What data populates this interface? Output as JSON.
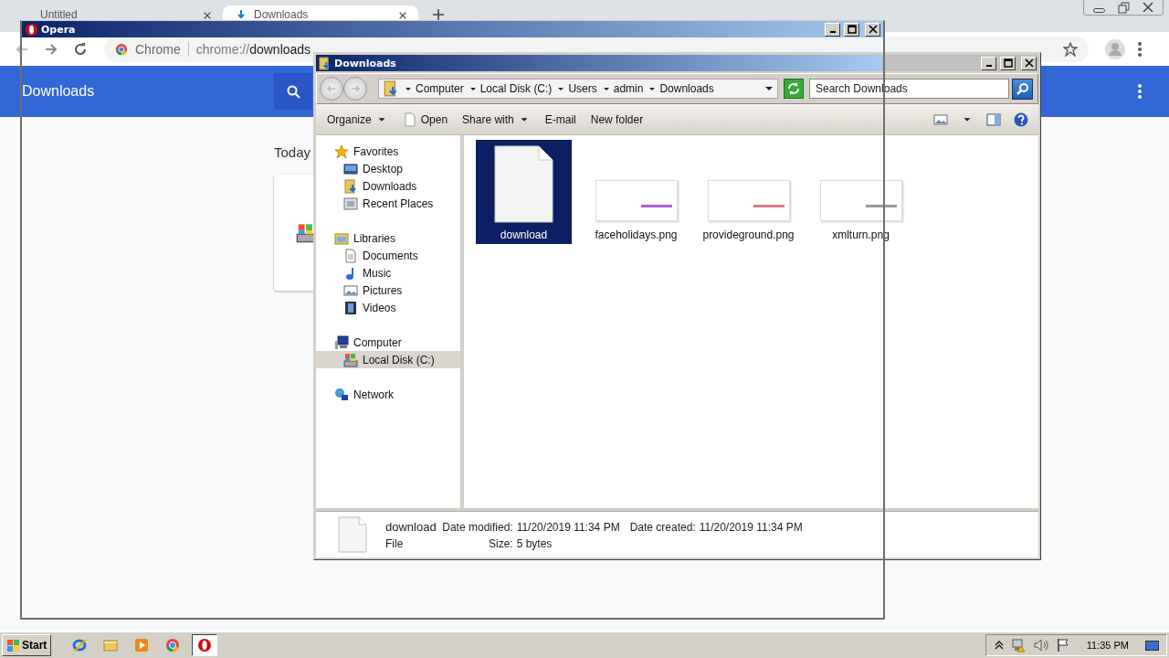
{
  "chrome": {
    "tabs": [
      {
        "label": "Untitled",
        "selected": false
      },
      {
        "label": "Downloads",
        "selected": true
      }
    ],
    "omnibox": {
      "site": "Chrome",
      "url_scheme": "chrome://",
      "url_path": "downloads"
    },
    "header": {
      "title": "Downloads"
    },
    "section": "Today"
  },
  "opera": {
    "title": "Opera"
  },
  "explorer": {
    "title": "Downloads",
    "breadcrumb": [
      "Computer",
      "Local Disk (C:)",
      "Users",
      "admin",
      "Downloads"
    ],
    "search": {
      "placeholder": "Search Downloads"
    },
    "commands": [
      {
        "label": "Organize",
        "kind": "menu"
      },
      {
        "label": "Open",
        "kind": "page"
      },
      {
        "label": "Share with",
        "kind": "menu"
      },
      {
        "label": "E-mail",
        "kind": "plain"
      },
      {
        "label": "New folder",
        "kind": "plain"
      }
    ],
    "nav": [
      {
        "label": "Favorites",
        "kind": "star",
        "selected": false,
        "children": [
          {
            "label": "Desktop",
            "kind": "desktop",
            "selected": false
          },
          {
            "label": "Downloads",
            "kind": "downloads",
            "selected": false
          },
          {
            "label": "Recent Places",
            "kind": "recent",
            "selected": false
          }
        ]
      },
      {
        "label": "Libraries",
        "kind": "library",
        "selected": false,
        "children": [
          {
            "label": "Documents",
            "kind": "document",
            "selected": false
          },
          {
            "label": "Music",
            "kind": "music",
            "selected": false
          },
          {
            "label": "Pictures",
            "kind": "pictures",
            "selected": false
          },
          {
            "label": "Videos",
            "kind": "videos",
            "selected": false
          }
        ]
      },
      {
        "label": "Computer",
        "kind": "computer",
        "selected": false,
        "children": [
          {
            "label": "Local Disk (C:)",
            "kind": "disk",
            "selected": true
          }
        ]
      },
      {
        "label": "Network",
        "kind": "network",
        "selected": false
      }
    ],
    "files": [
      {
        "name": "download",
        "kind": "blank",
        "selected": true
      },
      {
        "name": "faceholidays.png",
        "kind": "image",
        "color": "#b05fd8",
        "selected": false
      },
      {
        "name": "provideground.png",
        "kind": "image",
        "color": "#e07a8a",
        "selected": false
      },
      {
        "name": "xmlturn.png",
        "kind": "image",
        "color": "#9a9a9a",
        "selected": false
      }
    ],
    "details": {
      "name": "download",
      "type": "File",
      "columns": [
        [
          {
            "label": "Date modified:",
            "value": "11/20/2019 11:34 PM"
          },
          {
            "label": "Size:",
            "value": "5 bytes"
          }
        ],
        [
          {
            "label": "Date created:",
            "value": "11/20/2019 11:34 PM"
          }
        ]
      ]
    }
  },
  "taskbar": {
    "start": "Start",
    "apps": [
      {
        "kind": "ie",
        "selected": false
      },
      {
        "kind": "folder",
        "selected": false
      },
      {
        "kind": "media",
        "selected": false
      },
      {
        "kind": "chrome",
        "selected": false
      },
      {
        "kind": "opera",
        "selected": true
      }
    ],
    "clock": "11:35 PM"
  }
}
